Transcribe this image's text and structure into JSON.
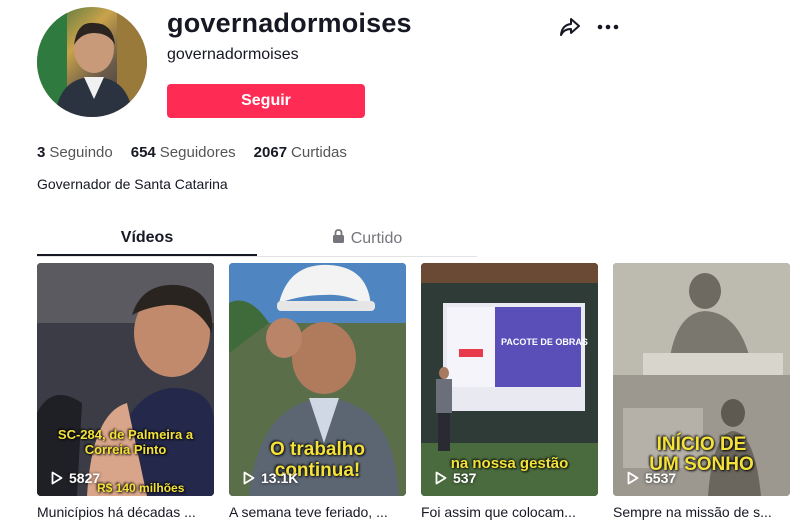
{
  "profile": {
    "title": "governadormoises",
    "subtitle": "governadormoises",
    "follow_label": "Seguir",
    "bio": "Governador de Santa Catarina"
  },
  "stats": [
    {
      "num": "3",
      "label": "Seguindo"
    },
    {
      "num": "654",
      "label": "Seguidores"
    },
    {
      "num": "2067",
      "label": "Curtidas"
    }
  ],
  "tabs": {
    "videos": "Vídeos",
    "liked": "Curtido"
  },
  "videos": [
    {
      "views": "5827",
      "overlay": "SC-284, de Palmeira a Correia Pinto",
      "overlay2": "R$ 140 milhões",
      "desc": "Municípios há décadas ..."
    },
    {
      "views": "13.1K",
      "overlay": "O trabalho continua!",
      "desc": "A semana teve feriado, ..."
    },
    {
      "views": "537",
      "overlay": "na nossa gestão",
      "screen": "PACOTE DE OBRAS",
      "desc": "Foi assim que colocam..."
    },
    {
      "views": "5537",
      "overlay": "INÍCIO DE UM SONHO",
      "desc": "Sempre na missão de s..."
    }
  ],
  "icons": {
    "share": "share-icon",
    "more": "more-options-icon",
    "lock": "lock-icon",
    "play": "play-icon"
  },
  "colors": {
    "accent": "#fe2c55",
    "overlay_text": "#f4e23a"
  }
}
